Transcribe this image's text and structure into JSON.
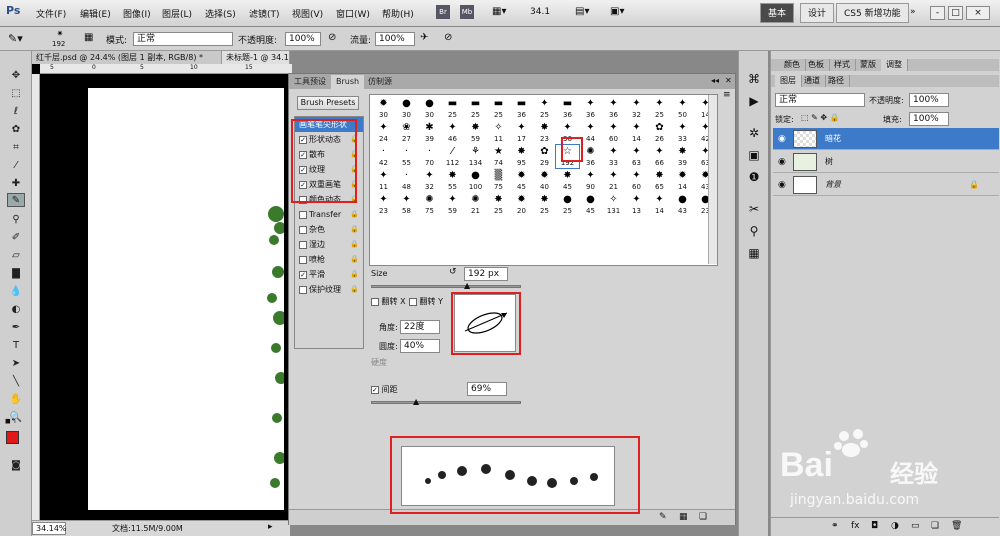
{
  "app": {
    "logo": "Ps",
    "menu": [
      "文件(F)",
      "编辑(E)",
      "图像(I)",
      "图层(L)",
      "选择(S)",
      "滤镜(T)",
      "视图(V)",
      "窗口(W)",
      "帮助(H)"
    ],
    "zoom_value": "34.1",
    "workspaces": [
      "基本",
      "设计",
      "CS5 新增功能"
    ],
    "active_workspace": "基本",
    "window_controls": [
      "-",
      "□",
      "×"
    ]
  },
  "options": {
    "brush_size": "192",
    "mode_label": "模式:",
    "mode_value": "正常",
    "opacity_label": "不透明度:",
    "opacity_value": "100%",
    "flow_label": "流量:",
    "flow_value": "100%"
  },
  "doc_tabs": [
    "红千层.psd @ 24.4% (图层 1 副本, RGB/8) *",
    "未标题-1 @ 34.1% (暗花, RGB/8) *"
  ],
  "status": {
    "zoom": "34.14%",
    "doc": "文档:11.5M/9.00M"
  },
  "ruler_top": [
    "5",
    "0",
    "5",
    "10",
    "15"
  ],
  "brush_panel": {
    "tabs": [
      "工具预设",
      "Brush",
      "仿制源"
    ],
    "active_tab": "Brush",
    "presets_button": "Brush Presets",
    "options": [
      {
        "label": "画笔笔尖形状",
        "checkbox": false,
        "locked": false,
        "selected": true
      },
      {
        "label": "形状动态",
        "checkbox": true,
        "checked": true,
        "locked": true
      },
      {
        "label": "散布",
        "checkbox": true,
        "checked": true,
        "locked": true
      },
      {
        "label": "纹理",
        "checkbox": true,
        "checked": true,
        "locked": true
      },
      {
        "label": "双重画笔",
        "checkbox": true,
        "checked": true,
        "locked": true
      },
      {
        "label": "颜色动态",
        "checkbox": true,
        "checked": false,
        "locked": true
      },
      {
        "label": "Transfer",
        "checkbox": true,
        "checked": false,
        "locked": true
      },
      {
        "label": "杂色",
        "checkbox": true,
        "checked": false,
        "locked": true
      },
      {
        "label": "湿边",
        "checkbox": true,
        "checked": false,
        "locked": true
      },
      {
        "label": "喷枪",
        "checkbox": true,
        "checked": false,
        "locked": true
      },
      {
        "label": "平滑",
        "checkbox": true,
        "checked": true,
        "locked": true
      },
      {
        "label": "保护纹理",
        "checkbox": true,
        "checked": false,
        "locked": true
      }
    ],
    "brush_rows": [
      {
        "glyphs": [
          "✹",
          "●",
          "●",
          "▬",
          "▬",
          "▬",
          "▬",
          "✦",
          "▬",
          "✦",
          "✦",
          "✦",
          "✦",
          "✦",
          "✦"
        ],
        "sizes": [
          "30",
          "30",
          "30",
          "25",
          "25",
          "25",
          "36",
          "25",
          "36",
          "36",
          "36",
          "32",
          "25",
          "50",
          "14"
        ]
      },
      {
        "glyphs": [
          "✦",
          "❀",
          "✱",
          "✦",
          "✸",
          "✧",
          "✦",
          "✸",
          "✦",
          "✦",
          "✦",
          "✦",
          "✿",
          "✦",
          "✦"
        ],
        "sizes": [
          "24",
          "27",
          "39",
          "46",
          "59",
          "11",
          "17",
          "23",
          "36",
          "44",
          "60",
          "14",
          "26",
          "33",
          "42"
        ]
      },
      {
        "glyphs": [
          "·",
          "·",
          "·",
          "⁄",
          "⚘",
          "★",
          "✸",
          "✿",
          "☆",
          "✺",
          "✦",
          "✦",
          "✦",
          "✸",
          "✦"
        ],
        "sizes": [
          "42",
          "55",
          "70",
          "112",
          "134",
          "74",
          "95",
          "29",
          "192",
          "36",
          "33",
          "63",
          "66",
          "39",
          "63"
        ]
      },
      {
        "glyphs": [
          "✦",
          "·",
          "✦",
          "✸",
          "●",
          "▒",
          "✹",
          "✹",
          "✸",
          "✦",
          "✦",
          "✦",
          "✸",
          "✹",
          "✹"
        ],
        "sizes": [
          "11",
          "48",
          "32",
          "55",
          "100",
          "75",
          "45",
          "40",
          "45",
          "90",
          "21",
          "60",
          "65",
          "14",
          "43"
        ]
      },
      {
        "glyphs": [
          "✦",
          "✦",
          "✺",
          "✦",
          "✺",
          "✸",
          "✹",
          "✸",
          "●",
          "●",
          "✧",
          "✦",
          "✦",
          "●",
          "●"
        ],
        "sizes": [
          "23",
          "58",
          "75",
          "59",
          "21",
          "25",
          "20",
          "25",
          "25",
          "45",
          "131",
          "13",
          "14",
          "43",
          "23"
        ]
      }
    ],
    "selected_brush": "192",
    "size_label": "Size",
    "size_value": "192 px",
    "flip_x": "翻转 X",
    "flip_y": "翻转 Y",
    "angle_label": "角度:",
    "angle_value": "22度",
    "roundness_label": "圆度:",
    "roundness_value": "40%",
    "hardness_label": "硬度",
    "spacing_label": "间距",
    "spacing_value": "69%"
  },
  "layers_panel": {
    "top_tabs": [
      "颜色",
      "色板",
      "样式",
      "蒙版",
      "调整"
    ],
    "tabs": [
      "图层",
      "通道",
      "路径"
    ],
    "blend_mode": "正常",
    "opacity_label": "不透明度:",
    "opacity_value": "100%",
    "lock_label": "锁定:",
    "fill_label": "填充:",
    "fill_value": "100%",
    "layers": [
      {
        "name": "暗花",
        "selected": true
      },
      {
        "name": "树",
        "selected": false
      },
      {
        "name": "背景",
        "selected": false,
        "locked": true
      }
    ]
  },
  "watermark": {
    "brand_left": "Bai",
    "brand_right": "经验",
    "url": "jingyan.baidu.com"
  },
  "colors": {
    "foreground": "#e01818",
    "selection": "#3d7ac9",
    "highlight": "#e02020"
  }
}
